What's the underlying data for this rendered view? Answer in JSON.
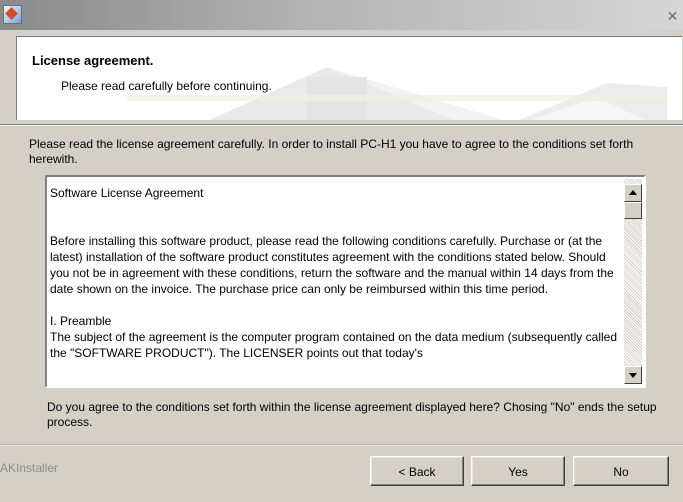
{
  "header": {
    "title": "License agreement.",
    "subtitle": "Please read carefully before continuing."
  },
  "intro_text": "Please read the license agreement carefully. In order to install PC-H1 you have to agree to the conditions set forth herewith.",
  "license": {
    "paragraphs": [
      "Software License Agreement",
      "Before installing this software product, please read the following conditions carefully. Purchase or (at the latest) installation of the software product constitutes agreement with the conditions stated below.  Should you not be in agreement with these conditions, return the software and the manual within 14 days from the date shown on the invoice.  The purchase price can only be reimbursed within this time period.",
      "I. Preamble",
      "The subject of the agreement is the computer program contained on the data medium (subsequently called the \"SOFTWARE PRODUCT\").  The LICENSER points out that today's"
    ]
  },
  "question_text": "Do you agree to the conditions set forth within the license agreement displayed here? Chosing \"No\" ends the setup process.",
  "footer": {
    "brand": "AKInstaller",
    "back_label": "< Back",
    "yes_label": "Yes",
    "no_label": "No"
  },
  "icons": {
    "app": "installer-app-icon",
    "close": "close-icon",
    "scroll_up": "scroll-up-arrow-icon",
    "scroll_down": "scroll-down-arrow-icon"
  }
}
